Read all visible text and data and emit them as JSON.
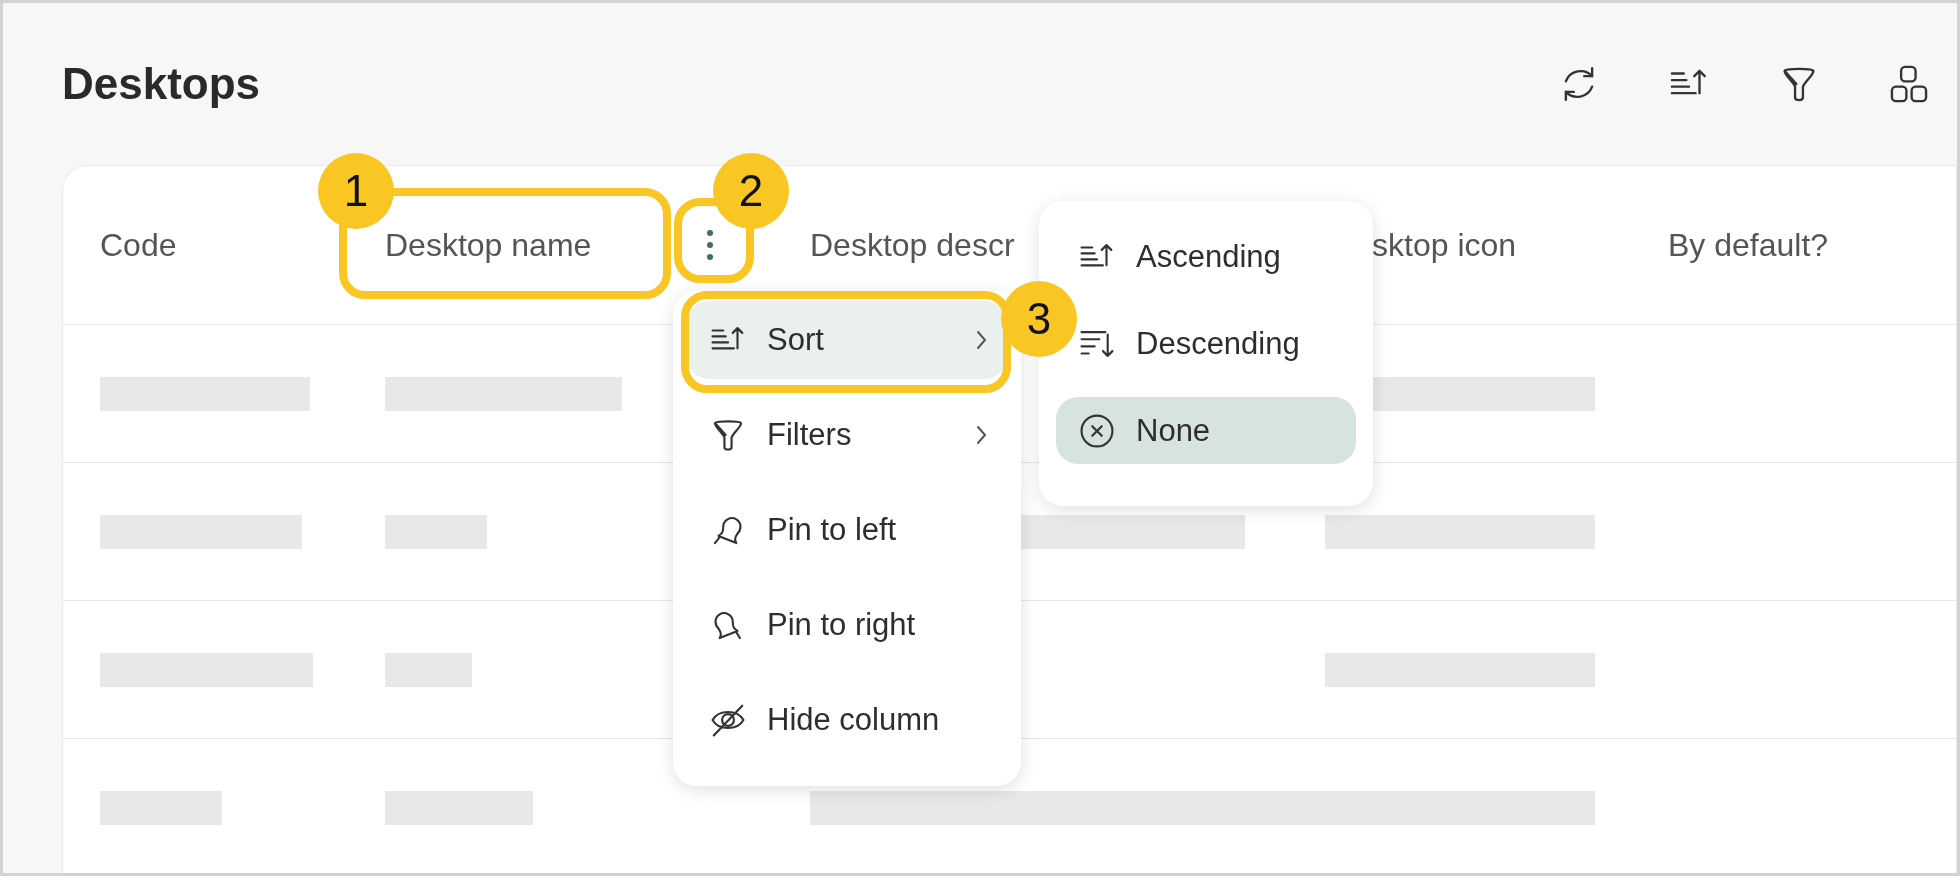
{
  "page": {
    "title": "Desktops"
  },
  "toolbar": [
    {
      "kind": "refresh"
    },
    {
      "kind": "sort"
    },
    {
      "kind": "filter"
    },
    {
      "kind": "grid"
    }
  ],
  "table": {
    "columns": [
      {
        "label": "Code",
        "has_menu": false
      },
      {
        "label": "Desktop name",
        "has_menu": true
      },
      {
        "label": "Desktop descr",
        "has_menu": false
      },
      {
        "label": "sktop icon",
        "has_menu": false
      },
      {
        "label": "By default?",
        "has_menu": false
      }
    ],
    "rows": [
      {
        "cells": [
          {
            "kind": "skeleton"
          },
          {
            "kind": "skeleton"
          },
          {
            "kind": "empty"
          },
          {
            "kind": "skeleton"
          },
          {
            "kind": "empty"
          }
        ]
      },
      {
        "cells": [
          {
            "kind": "skeleton"
          },
          {
            "kind": "skeleton"
          },
          {
            "kind": "skeleton"
          },
          {
            "kind": "skeleton"
          },
          {
            "kind": "empty"
          }
        ]
      },
      {
        "cells": [
          {
            "kind": "skeleton"
          },
          {
            "kind": "skeleton"
          },
          {
            "kind": "empty"
          },
          {
            "kind": "skeleton"
          },
          {
            "kind": "empty"
          }
        ]
      },
      {
        "cells": [
          {
            "kind": "skeleton"
          },
          {
            "kind": "skeleton"
          },
          {
            "kind": "skeleton"
          },
          {
            "kind": "skeleton"
          },
          {
            "kind": "empty"
          }
        ]
      }
    ]
  },
  "column_menu": {
    "items": [
      {
        "label": "Sort",
        "submenu": true,
        "selected": true
      },
      {
        "label": "Filters",
        "submenu": true,
        "selected": false
      },
      {
        "label": "Pin to left",
        "submenu": false,
        "selected": false
      },
      {
        "label": "Pin to right",
        "submenu": false,
        "selected": false
      },
      {
        "label": "Hide column",
        "submenu": false,
        "selected": false
      }
    ]
  },
  "sort_submenu": {
    "items": [
      {
        "label": "Ascending",
        "selected": false
      },
      {
        "label": "Descending",
        "selected": false
      },
      {
        "label": "None",
        "selected": true
      }
    ]
  },
  "callouts": [
    {
      "number": "1"
    },
    {
      "number": "2"
    },
    {
      "number": "3"
    }
  ]
}
